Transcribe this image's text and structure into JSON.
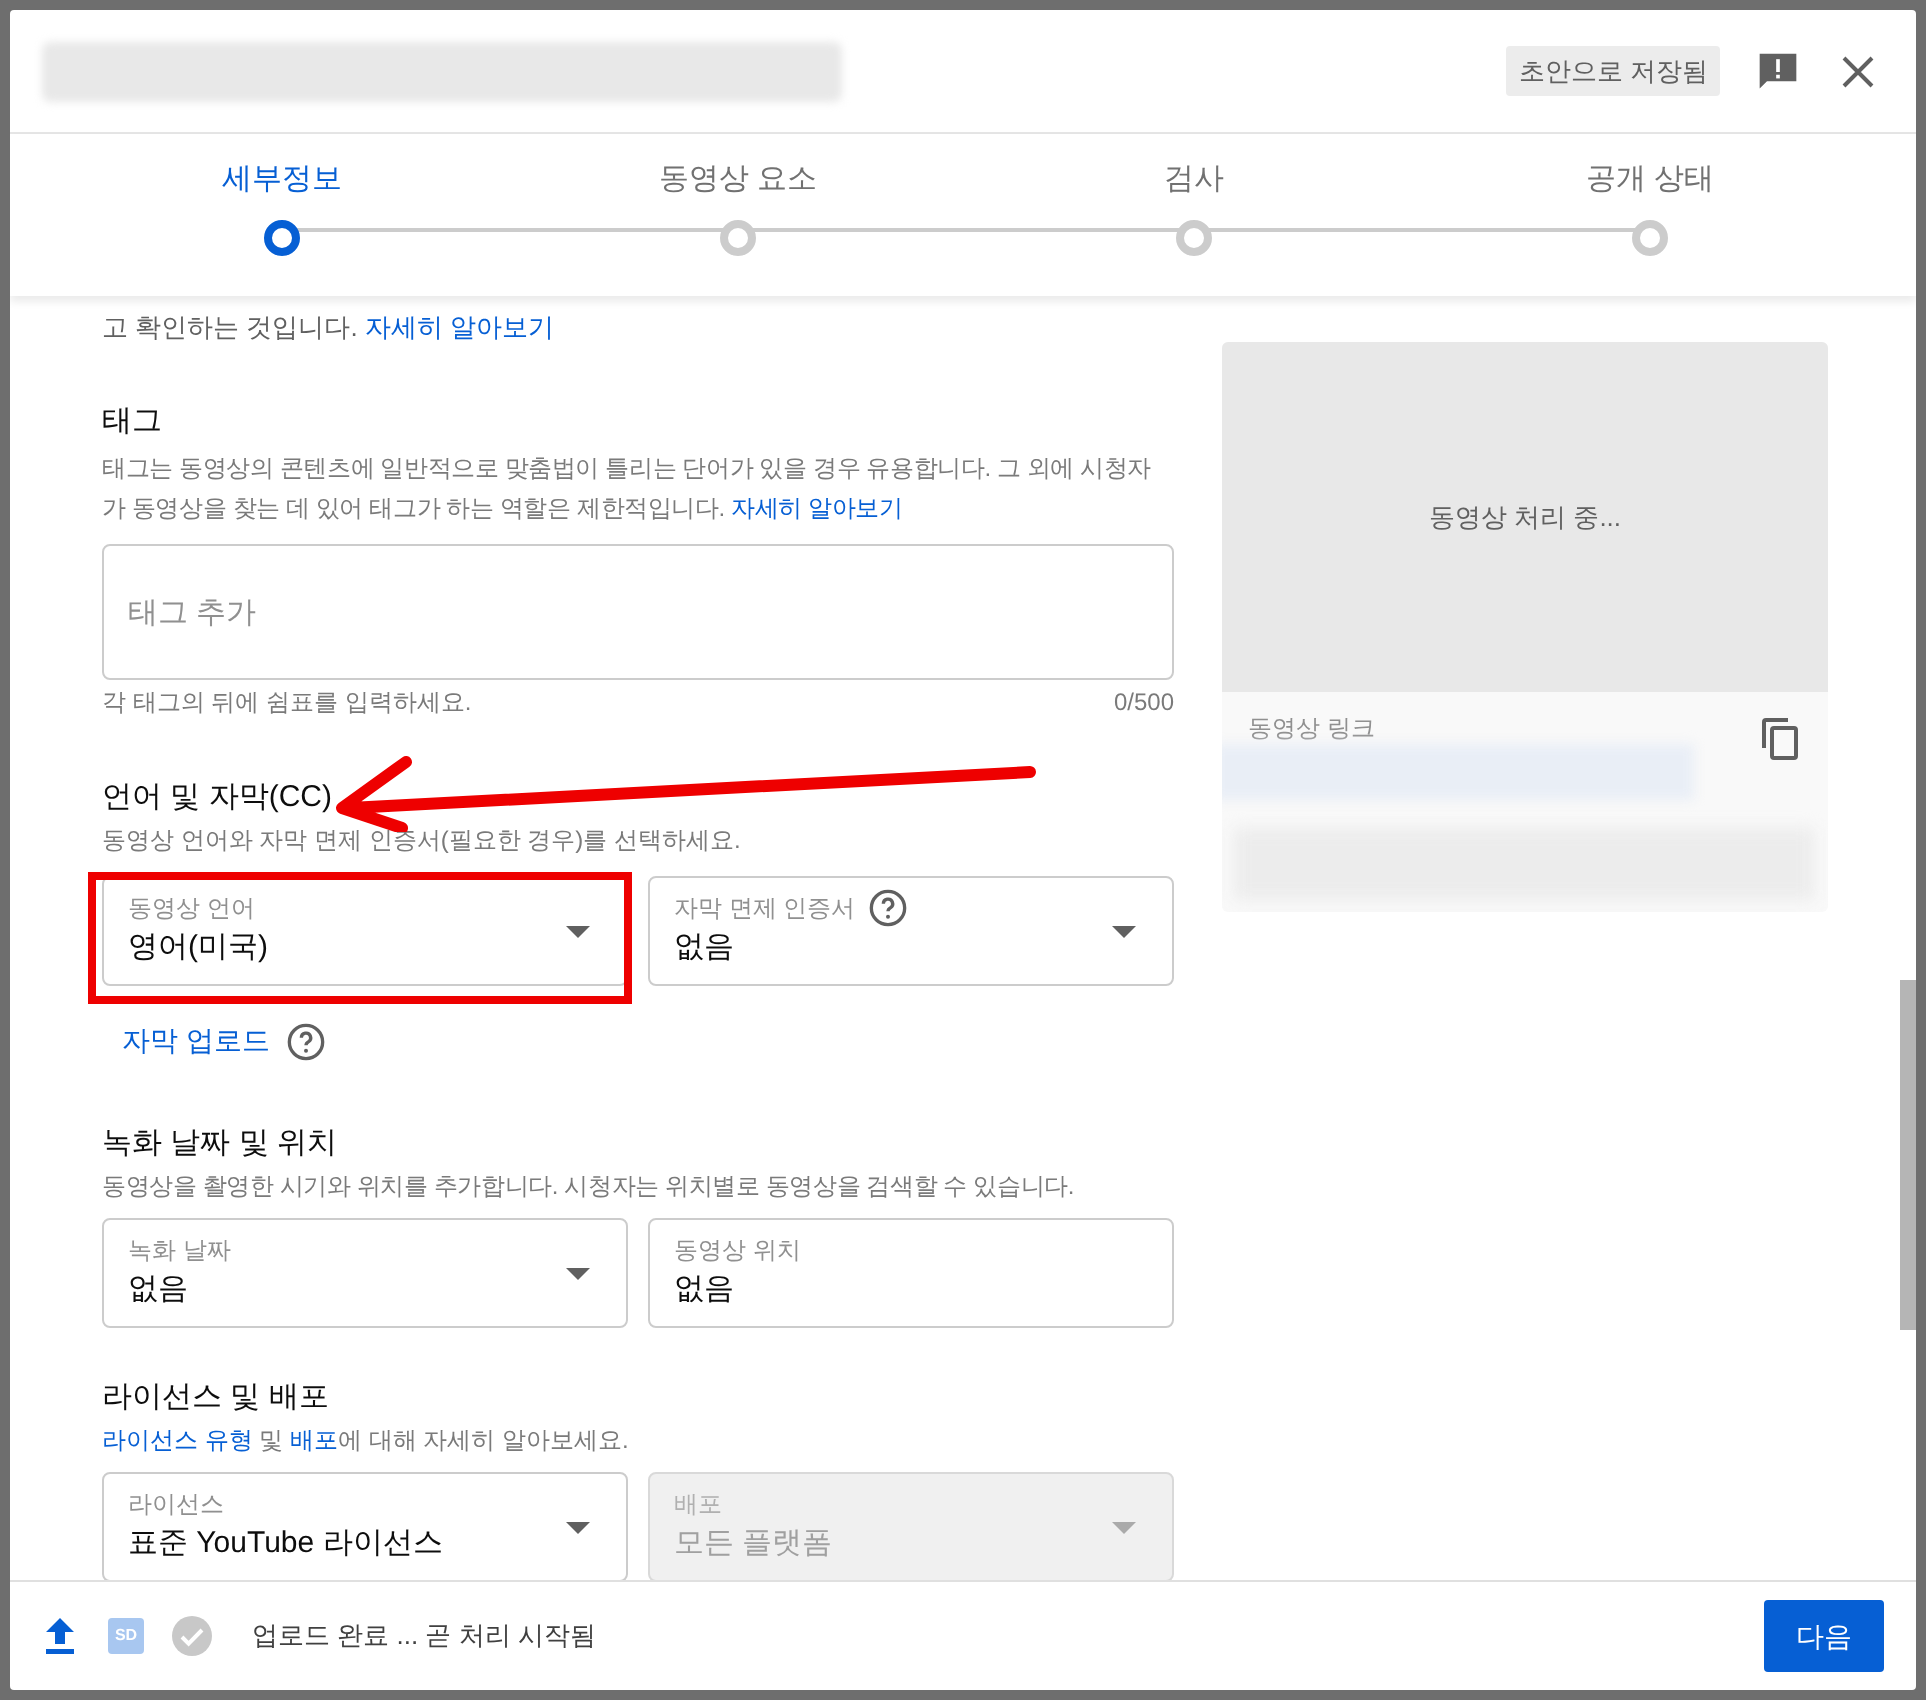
{
  "header": {
    "status_badge": "초안으로 저장됨"
  },
  "steps": [
    {
      "label": "세부정보",
      "selected": true
    },
    {
      "label": "동영상 요소",
      "selected": false
    },
    {
      "label": "검사",
      "selected": false
    },
    {
      "label": "공개 상태",
      "selected": false
    }
  ],
  "intro": {
    "text": "고 확인하는 것입니다.",
    "link": "자세히 알아보기"
  },
  "tags": {
    "title": "태그",
    "description": "태그는 동영상의 콘텐츠에 일반적으로 맞춤법이 틀리는 단어가 있을 경우 유용합니다. 그 외에 시청자가 동영상을 찾는 데 있어 태그가 하는 역할은 제한적입니다.",
    "link": "자세히 알아보기",
    "field": {
      "placeholder": "태그 추가"
    },
    "hint": "각 태그의 뒤에 쉼표를 입력하세요.",
    "counter": "0/500"
  },
  "language": {
    "title": "언어 및 자막(CC)",
    "description": "동영상 언어와 자막 면제 인증서(필요한 경우)를 선택하세요.",
    "fields": [
      {
        "kind": "select",
        "label": "동영상 언어",
        "value": "영어(미국)",
        "help": false,
        "disabled": false
      },
      {
        "kind": "select",
        "label": "자막 면제 인증서",
        "value": "없음",
        "help": true,
        "disabled": false
      }
    ],
    "upload_link": "자막 업로드"
  },
  "recording": {
    "title": "녹화 날짜 및 위치",
    "description": "동영상을 촬영한 시기와 위치를 추가합니다. 시청자는 위치별로 동영상을 검색할 수 있습니다.",
    "fields": [
      {
        "kind": "select",
        "label": "녹화 날짜",
        "value": "없음",
        "help": false,
        "disabled": false
      },
      {
        "kind": "text",
        "label": "동영상 위치",
        "value": "없음",
        "help": false,
        "disabled": false
      }
    ]
  },
  "license": {
    "title": "라이선스 및 배포",
    "description": [
      {
        "text": "라이선스 유형",
        "link": true
      },
      {
        "text": " 및 ",
        "link": false
      },
      {
        "text": "배포",
        "link": true
      },
      {
        "text": "에 대해 자세히 알아보세요.",
        "link": false
      }
    ],
    "fields": [
      {
        "kind": "select",
        "label": "라이선스",
        "value": "표준 YouTube 라이선스",
        "help": false,
        "disabled": false
      },
      {
        "kind": "select",
        "label": "배포",
        "value": "모든 플랫폼",
        "help": false,
        "disabled": true
      }
    ]
  },
  "preview": {
    "status": "동영상 처리 중...",
    "link_label": "동영상 링크"
  },
  "footer": {
    "quality_badge": "SD",
    "status": "업로드 완료 ... 곧 처리 시작됨",
    "next_button": "다음"
  }
}
